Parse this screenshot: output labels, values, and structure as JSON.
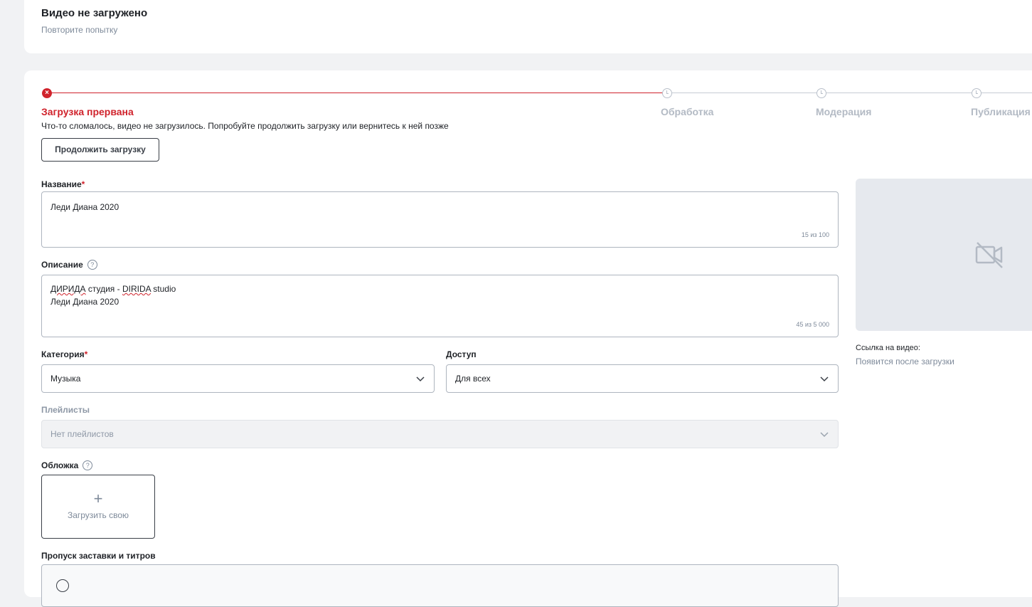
{
  "status_card": {
    "title": "Видео не загружено",
    "retry_link": "Повторите попытку"
  },
  "stepper": {
    "steps": [
      {
        "label": "Загрузка прервана",
        "state": "error"
      },
      {
        "label": "Обработка",
        "state": "pending"
      },
      {
        "label": "Модерация",
        "state": "pending"
      },
      {
        "label": "Публикация",
        "state": "pending"
      }
    ],
    "error_message": "Что-то сломалось, видео не загрузилось. Попробуйте продолжить загрузку или вернитесь к ней позже",
    "continue_button": "Продолжить загрузку"
  },
  "form": {
    "title_field": {
      "label": "Название",
      "required_mark": "*",
      "value": "Леди Диана 2020",
      "counter": "15 из 100"
    },
    "description_field": {
      "label": "Описание",
      "help_icon": "?",
      "line1_a": "ДИРИДА",
      "line1_b": " студия - ",
      "line1_c": "DIRIDA",
      "line1_d": " studio",
      "line2": "Леди Диана 2020",
      "counter": "45 из 5 000"
    },
    "category": {
      "label": "Категория",
      "required_mark": "*",
      "value": "Музыка"
    },
    "access": {
      "label": "Доступ",
      "value": "Для всех"
    },
    "playlists": {
      "label": "Плейлисты",
      "value": "Нет плейлистов"
    },
    "cover": {
      "label": "Обложка",
      "help_icon": "?",
      "plus": "+",
      "upload_label": "Загрузить свою"
    },
    "skip_intro": {
      "label": "Пропуск заставки и титров"
    }
  },
  "sidebar": {
    "link_label": "Ссылка на видео:",
    "link_value": "Появится после загрузки"
  },
  "colors": {
    "accent_error": "#d0232c",
    "background": "#f1f2f4"
  }
}
